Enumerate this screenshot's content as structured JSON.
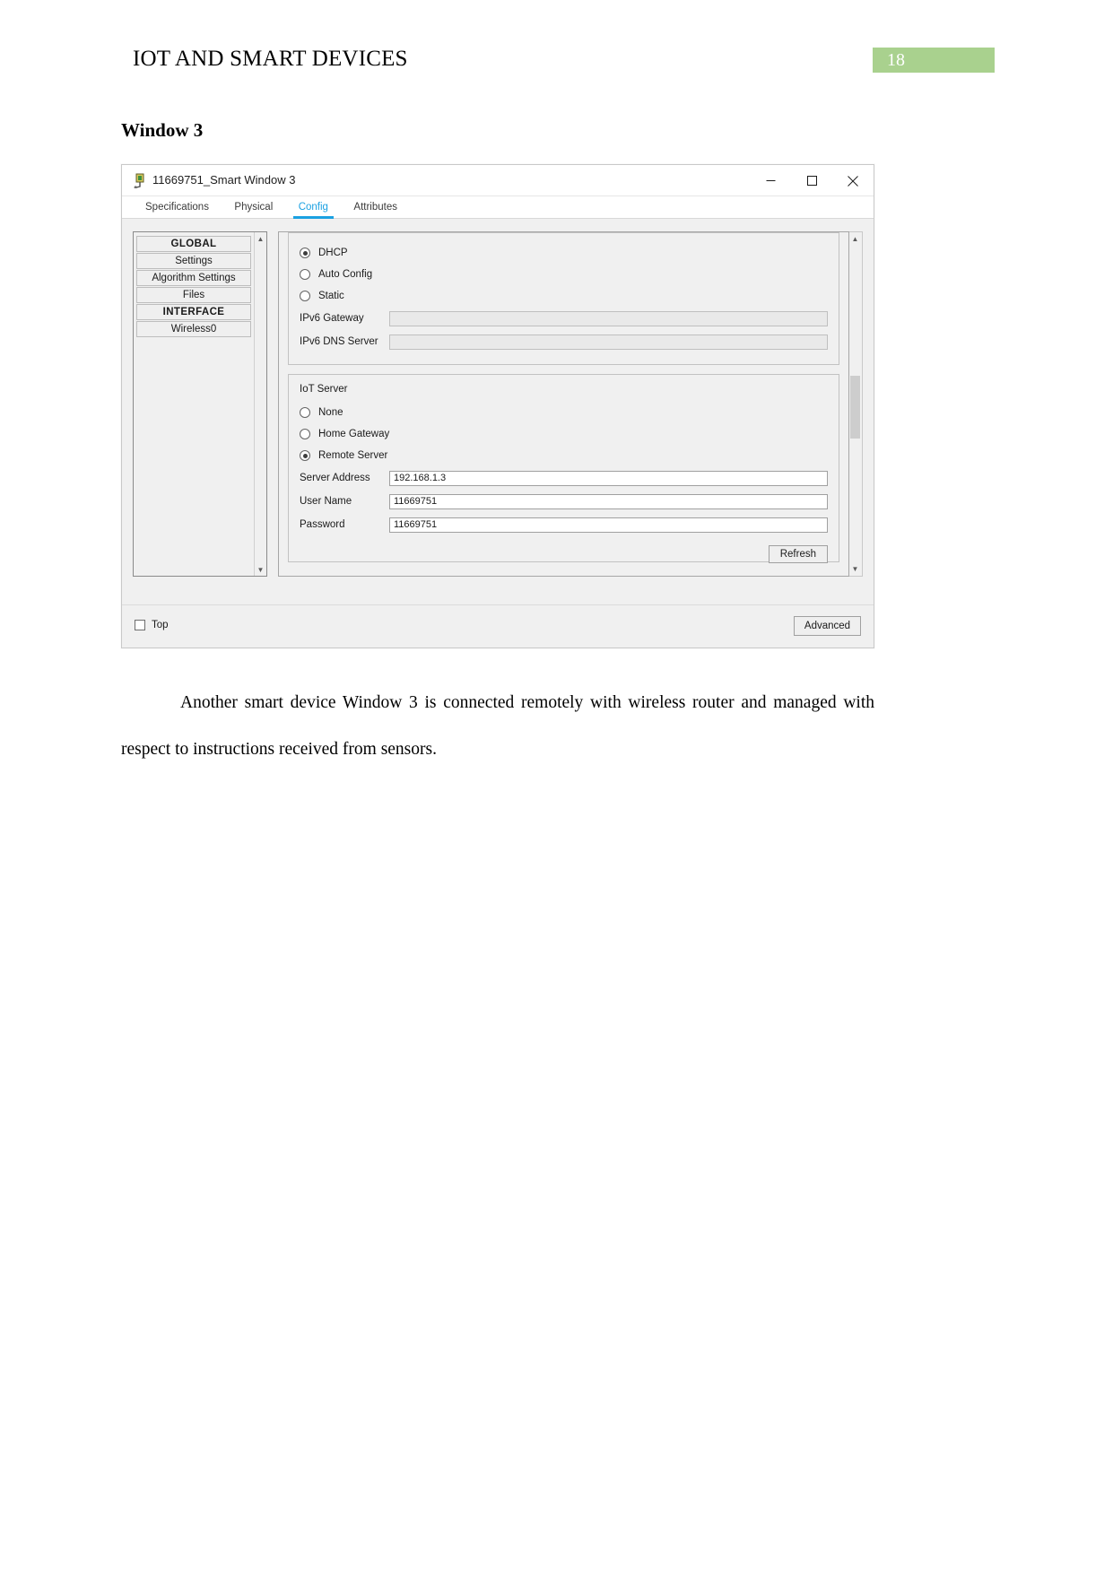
{
  "document": {
    "header_title": "IOT AND SMART DEVICES",
    "page_number": "18",
    "page_badge_color": "#a9d18e",
    "section_heading": "Window 3",
    "paragraph": "Another smart device Window 3 is connected remotely with wireless router and managed with respect to instructions received from sensors."
  },
  "window": {
    "title": "11669751_Smart Window 3",
    "icon_name": "packet-tracer-device-icon",
    "controls": {
      "minimize": "minimize-icon",
      "maximize": "maximize-icon",
      "close": "close-icon"
    },
    "tabs": [
      {
        "label": "Specifications",
        "active": false
      },
      {
        "label": "Physical",
        "active": false
      },
      {
        "label": "Config",
        "active": true
      },
      {
        "label": "Attributes",
        "active": false
      }
    ],
    "active_tab_color": "#1ba1e2",
    "sidebar": {
      "items": [
        {
          "label": "GLOBAL",
          "is_header": true
        },
        {
          "label": "Settings",
          "is_header": false
        },
        {
          "label": "Algorithm Settings",
          "is_header": false
        },
        {
          "label": "Files",
          "is_header": false
        },
        {
          "label": "INTERFACE",
          "is_header": true
        },
        {
          "label": "Wireless0",
          "is_header": false
        }
      ],
      "scroll_up_icon": "chevron-up-icon",
      "scroll_down_icon": "chevron-down-icon"
    },
    "ipv6_group": {
      "options": [
        {
          "label": "DHCP",
          "selected": true
        },
        {
          "label": "Auto Config",
          "selected": false
        },
        {
          "label": "Static",
          "selected": false
        }
      ],
      "fields": [
        {
          "label": "IPv6 Gateway",
          "value": "",
          "disabled": true
        },
        {
          "label": "IPv6 DNS Server",
          "value": "",
          "disabled": true
        }
      ]
    },
    "iot_group": {
      "title": "IoT Server",
      "options": [
        {
          "label": "None",
          "selected": false
        },
        {
          "label": "Home Gateway",
          "selected": false
        },
        {
          "label": "Remote Server",
          "selected": true
        }
      ],
      "fields": [
        {
          "label": "Server Address",
          "value": "192.168.1.3"
        },
        {
          "label": "User Name",
          "value": "11669751"
        },
        {
          "label": "Password",
          "value": "11669751"
        }
      ],
      "refresh_button": "Refresh"
    },
    "footer": {
      "top_checkbox_label": "Top",
      "top_checked": false,
      "advanced_button": "Advanced"
    }
  }
}
